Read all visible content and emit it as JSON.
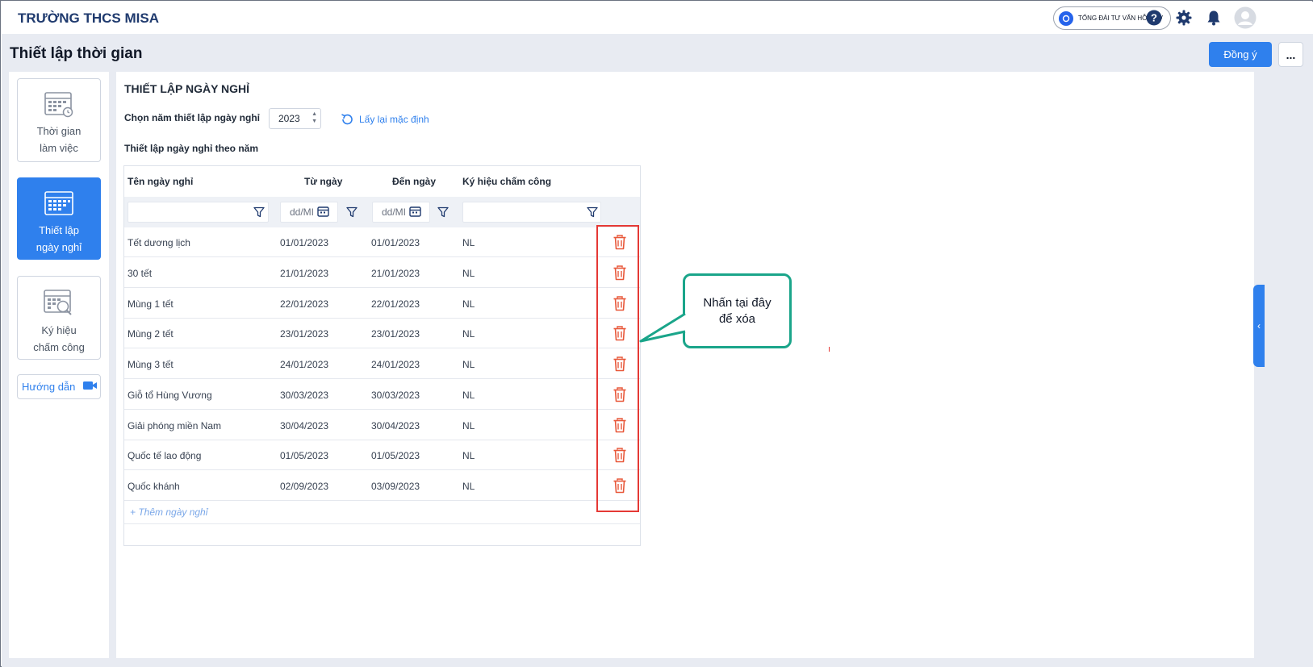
{
  "app": {
    "brand": "TRƯỜNG THCS MISA"
  },
  "topbar": {
    "support_label": "TỔNG ĐÀI TƯ VẤN HỖ TRỢ",
    "icons": [
      "help-icon",
      "gear-icon",
      "bell-icon",
      "avatar-icon"
    ]
  },
  "page": {
    "title": "Thiết lập thời gian",
    "agree_button": "Đồng ý",
    "more_button": "..."
  },
  "sidebar": {
    "items": [
      {
        "line1": "Thời gian",
        "line2": "làm việc",
        "icon": "calendar-clock-icon",
        "active": false
      },
      {
        "line1": "Thiết lập",
        "line2": "ngày nghỉ",
        "icon": "calendar-icon",
        "active": true
      },
      {
        "line1": "Ký hiệu",
        "line2": "chấm công",
        "icon": "calendar-search-icon",
        "active": false
      }
    ],
    "guide_label": "Hướng dẫn"
  },
  "section": {
    "title": "THIẾT LẬP NGÀY NGHỈ",
    "year_label": "Chọn năm thiết lập ngày nghỉ",
    "year_value": "2023",
    "reset_label": "Lấy lại mặc định",
    "subtitle": "Thiết lập ngày nghỉ theo năm"
  },
  "table": {
    "headers": {
      "name": "Tên ngày nghỉ",
      "from": "Từ ngày",
      "to": "Đến ngày",
      "code": "Ký hiệu chấm công"
    },
    "date_placeholder": "dd/MI",
    "rows": [
      {
        "name": "Tết dương lịch",
        "from": "01/01/2023",
        "to": "01/01/2023",
        "code": "NL"
      },
      {
        "name": "30 tết",
        "from": "21/01/2023",
        "to": "21/01/2023",
        "code": "NL"
      },
      {
        "name": "Mùng 1 tết",
        "from": "22/01/2023",
        "to": "22/01/2023",
        "code": "NL"
      },
      {
        "name": "Mùng 2 tết",
        "from": "23/01/2023",
        "to": "23/01/2023",
        "code": "NL"
      },
      {
        "name": "Mùng 3 tết",
        "from": "24/01/2023",
        "to": "24/01/2023",
        "code": "NL"
      },
      {
        "name": "Giỗ tổ Hùng Vương",
        "from": "30/03/2023",
        "to": "30/03/2023",
        "code": "NL"
      },
      {
        "name": "Giải phóng miền Nam",
        "from": "30/04/2023",
        "to": "30/04/2023",
        "code": "NL"
      },
      {
        "name": "Quốc tế lao động",
        "from": "01/05/2023",
        "to": "01/05/2023",
        "code": "NL"
      },
      {
        "name": "Quốc khánh",
        "from": "02/09/2023",
        "to": "03/09/2023",
        "code": "NL"
      }
    ],
    "add_label": "+ Thêm ngày nghỉ"
  },
  "callout": {
    "line1": "Nhấn tại đây",
    "line2": "để xóa"
  },
  "colors": {
    "primary": "#2f80ed",
    "danger": "#e53935",
    "callout_border": "#1aa58a",
    "workspace": "#e8ebf2"
  }
}
